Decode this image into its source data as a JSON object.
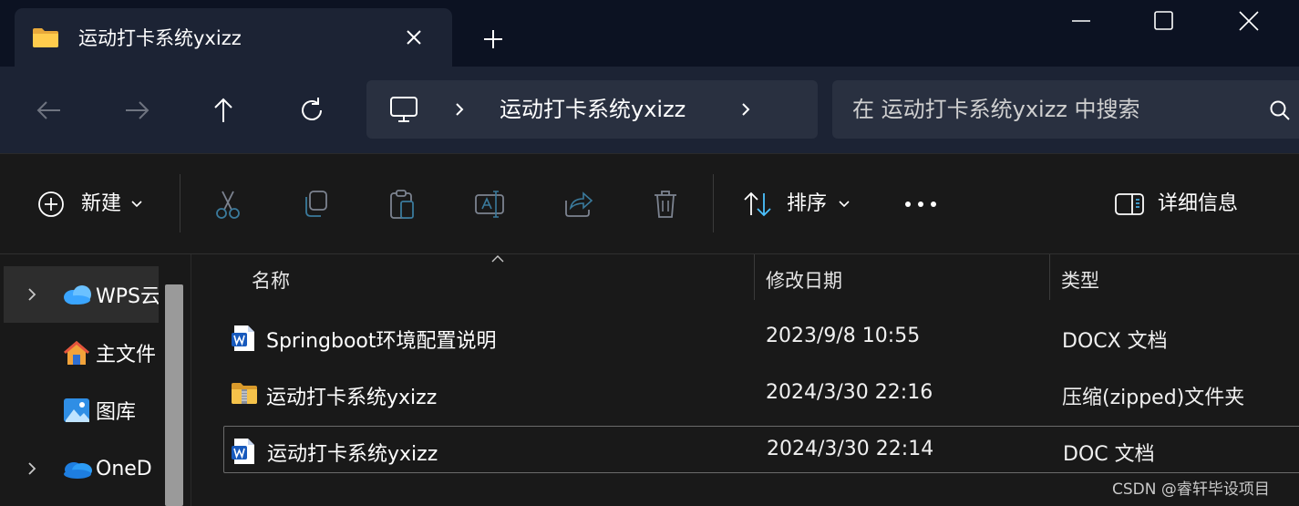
{
  "window": {
    "tab_title": "运动打卡系统yxizz",
    "controls": [
      "minimize",
      "maximize",
      "close"
    ]
  },
  "navigation": {
    "address_folder": "运动打卡系统yxizz",
    "search_placeholder": "在 运动打卡系统yxizz 中搜索"
  },
  "toolbar": {
    "new_label": "新建",
    "sort_label": "排序",
    "details_label": "详细信息"
  },
  "sidebar": {
    "items": [
      {
        "label": "WPS云",
        "icon": "cloud-icon",
        "expandable": true,
        "selected": true
      },
      {
        "label": "主文件",
        "icon": "home-icon",
        "expandable": false,
        "selected": false
      },
      {
        "label": "图库",
        "icon": "gallery-icon",
        "expandable": false,
        "selected": false
      },
      {
        "label": "OneD",
        "icon": "onedrive-icon",
        "expandable": true,
        "selected": false
      }
    ]
  },
  "columns": {
    "name": "名称",
    "modified": "修改日期",
    "type": "类型"
  },
  "files": [
    {
      "name": "Springboot环境配置说明",
      "modified": "2023/9/8 10:55",
      "type": "DOCX 文档",
      "icon": "word-doc-icon"
    },
    {
      "name": "运动打卡系统yxizz",
      "modified": "2024/3/30 22:16",
      "type": "压缩(zipped)文件夹",
      "icon": "zip-folder-icon"
    },
    {
      "name": "运动打卡系统yxizz",
      "modified": "2024/3/30 22:14",
      "type": "DOC 文档",
      "icon": "word-doc-icon"
    }
  ],
  "watermark": "CSDN @睿轩毕设项目",
  "colors": {
    "titlebar": "#0c1222",
    "navbar": "#1c2334",
    "field": "#293040",
    "body": "#191919",
    "accent": "#4cc2ff"
  }
}
